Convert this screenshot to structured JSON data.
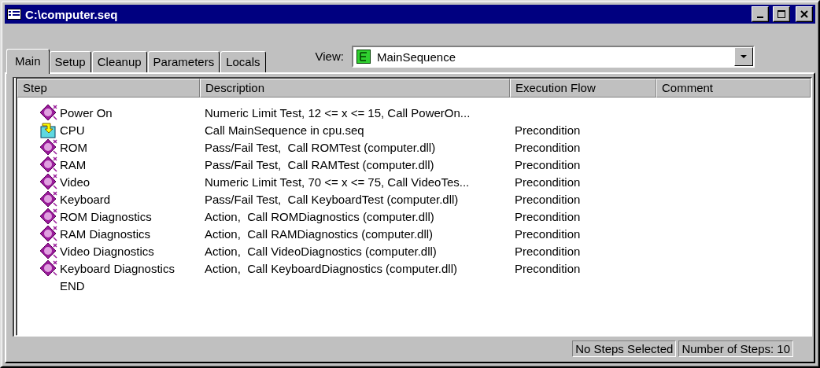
{
  "window": {
    "title": "C:\\computer.seq"
  },
  "tabs": [
    {
      "label": "Main",
      "selected": true
    },
    {
      "label": "Setup",
      "selected": false
    },
    {
      "label": "Cleanup",
      "selected": false
    },
    {
      "label": "Parameters",
      "selected": false
    },
    {
      "label": "Locals",
      "selected": false
    }
  ],
  "view": {
    "label": "View:",
    "value": "MainSequence"
  },
  "table": {
    "columns": [
      "Step",
      "Description",
      "Execution Flow",
      "Comment"
    ],
    "rows": [
      {
        "kind": "test",
        "step": "Power On",
        "description": "Numeric Limit Test, 12 <= x <= 15, Call PowerOn...",
        "flow": ""
      },
      {
        "kind": "sequence",
        "step": "CPU",
        "description": "Call MainSequence in cpu.seq",
        "flow": "Precondition"
      },
      {
        "kind": "test",
        "step": "ROM",
        "description": "Pass/Fail Test,  Call ROMTest (computer.dll)",
        "flow": "Precondition"
      },
      {
        "kind": "test",
        "step": "RAM",
        "description": "Pass/Fail Test,  Call RAMTest (computer.dll)",
        "flow": "Precondition"
      },
      {
        "kind": "test",
        "step": "Video",
        "description": "Numeric Limit Test, 70 <= x <= 75, Call VideoTes...",
        "flow": "Precondition"
      },
      {
        "kind": "test",
        "step": "Keyboard",
        "description": "Pass/Fail Test,  Call KeyboardTest (computer.dll)",
        "flow": "Precondition"
      },
      {
        "kind": "test",
        "step": "ROM Diagnostics",
        "description": "Action,  Call ROMDiagnostics (computer.dll)",
        "flow": "Precondition"
      },
      {
        "kind": "test",
        "step": "RAM Diagnostics",
        "description": "Action,  Call RAMDiagnostics (computer.dll)",
        "flow": "Precondition"
      },
      {
        "kind": "test",
        "step": "Video Diagnostics",
        "description": "Action,  Call VideoDiagnostics (computer.dll)",
        "flow": "Precondition"
      },
      {
        "kind": "test",
        "step": "Keyboard Diagnostics",
        "description": "Action,  Call KeyboardDiagnostics (computer.dll)",
        "flow": "Precondition"
      },
      {
        "kind": "end",
        "step": "END",
        "description": "",
        "flow": ""
      }
    ]
  },
  "status_bar": [
    "No Steps Selected",
    "Number of Steps: 10"
  ]
}
